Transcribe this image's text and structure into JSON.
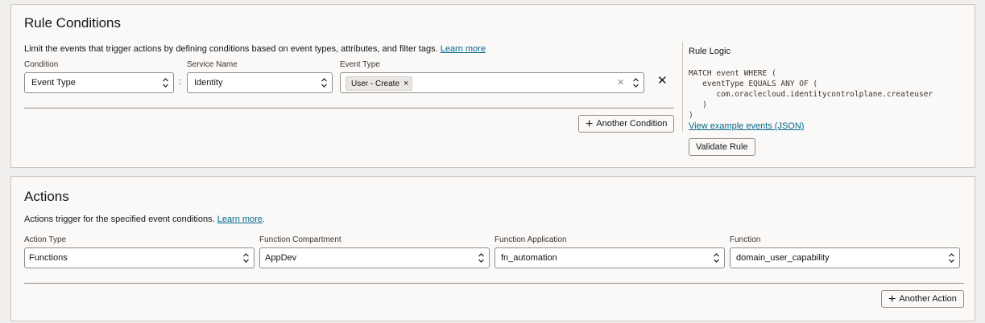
{
  "rule_conditions": {
    "title": "Rule Conditions",
    "description": "Limit the events that trigger actions by defining conditions based on event types, attributes, and filter tags.",
    "learn_more": "Learn more",
    "condition_label": "Condition",
    "condition_value": "Event Type",
    "colon": ":",
    "service_label": "Service Name",
    "service_value": "Identity",
    "event_type_label": "Event Type",
    "event_type_chip": "User - Create",
    "chip_remove": "×",
    "clear_glyph": "×",
    "remove_condition_glyph": "✕",
    "add_button": "Another Condition",
    "plus_glyph": "+"
  },
  "rule_logic": {
    "title": "Rule Logic",
    "code": [
      "MATCH event WHERE (",
      "   eventType EQUALS ANY OF (",
      "      com.oraclecloud.identitycontrolplane.createuser",
      "   )",
      ")"
    ],
    "example_link": "View example events (JSON)",
    "validate_button": "Validate Rule"
  },
  "actions": {
    "title": "Actions",
    "description": "Actions trigger for the specified event conditions.",
    "learn_more": "Learn more",
    "period": ".",
    "action_type_label": "Action Type",
    "action_type_value": "Functions",
    "compartment_label": "Function Compartment",
    "compartment_value": "AppDev",
    "application_label": "Function Application",
    "application_value": "fn_automation",
    "function_label": "Function",
    "function_value": "domain_user_capability",
    "add_button": "Another Action",
    "plus_glyph": "+"
  },
  "colors": {
    "link": "#00688c",
    "panel_bg": "#fbf9f8",
    "page_bg": "#f1efed",
    "border": "#8f8b86"
  },
  "icons": [
    "chevron-up-down-icon",
    "clear-icon",
    "close-icon",
    "plus-icon",
    "chip-remove-icon"
  ]
}
